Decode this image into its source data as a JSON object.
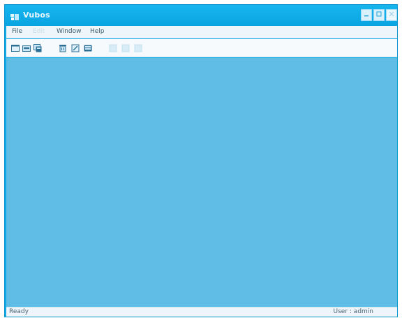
{
  "window": {
    "title": "Vubos",
    "controls": {
      "minimize_icon": "minimize-icon",
      "maximize_icon": "maximize-icon",
      "close_icon": "close-icon"
    }
  },
  "menu": {
    "file": "File",
    "edit": "Edit",
    "window": "Window",
    "help": "Help"
  },
  "toolbar": {
    "icons": [
      "new-icon",
      "open-icon",
      "save-icon",
      "delete-icon",
      "edit-icon",
      "print-icon",
      "cut-icon",
      "copy-icon",
      "paste-icon"
    ]
  },
  "status": {
    "left": "Ready",
    "right": "User : admin"
  },
  "colors": {
    "titlebar": "#0ea9e6",
    "workspace": "#5fbde6",
    "menubar": "#eef6fb"
  }
}
